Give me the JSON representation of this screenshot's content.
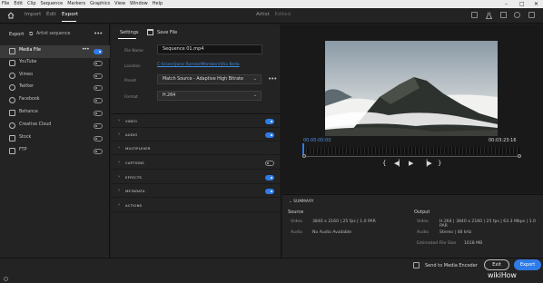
{
  "menu": [
    "File",
    "Edit",
    "Clip",
    "Sequence",
    "Markers",
    "Graphics",
    "View",
    "Window",
    "Help"
  ],
  "header": {
    "tabs": [
      {
        "label": "Import",
        "active": false
      },
      {
        "label": "Edit",
        "active": false
      },
      {
        "label": "Export",
        "active": true
      }
    ],
    "project": "Artist",
    "status": "Edited"
  },
  "left_panel": {
    "title": "Export",
    "sequence": "Artist sequence",
    "destinations": [
      {
        "label": "Media File",
        "on": true,
        "selected": true
      },
      {
        "label": "YouTube",
        "on": false
      },
      {
        "label": "Vimeo",
        "on": false
      },
      {
        "label": "Twitter",
        "on": false
      },
      {
        "label": "Facebook",
        "on": false
      },
      {
        "label": "Behance",
        "on": false
      },
      {
        "label": "Creative Cloud",
        "on": false
      },
      {
        "label": "Stock",
        "on": false
      },
      {
        "label": "FTP",
        "on": false
      }
    ]
  },
  "settings": {
    "tab": "Settings",
    "save_label": "Save File",
    "file_name_label": "File Name",
    "file_name": "Sequence 01.mp4",
    "location_label": "Location",
    "location": "C:\\Users\\Jane Romeo\\Members\\Rio Bella",
    "preset_label": "Preset",
    "preset": "Match Source - Adaptive High Bitrate",
    "format_label": "Format",
    "format": "H.264",
    "sections": [
      {
        "label": "VIDEO",
        "toggle": true,
        "on": true
      },
      {
        "label": "AUDIO",
        "toggle": true,
        "on": true
      },
      {
        "label": "MULTIPLEXER",
        "toggle": false
      },
      {
        "label": "CAPTIONS",
        "toggle": true,
        "on": false
      },
      {
        "label": "EFFECTS",
        "toggle": true,
        "on": true
      },
      {
        "label": "METADATA",
        "toggle": true,
        "on": true
      },
      {
        "label": "ACTIONS",
        "toggle": false
      }
    ]
  },
  "preview": {
    "tc_in": "00:00:00:00",
    "tc_out": "00:03:23:16",
    "playhead_position": 0.0
  },
  "summary": {
    "title": "SUMMARY",
    "source": {
      "heading": "Source",
      "video_label": "Video",
      "video": "3840 x 2160  |  25 fps  |  1.0 PAR",
      "audio_label": "Audio",
      "audio": "No Audio Available"
    },
    "output": {
      "heading": "Output",
      "video_label": "Video",
      "video": "H.264  |  3840 x 2160  |  25 fps  |  63.3 Mbps  |  1.0 PAR",
      "audio_label": "Audio",
      "audio": "Stereo  |  48 kHz",
      "size_label": "Estimated File Size",
      "size": "1618 MB"
    }
  },
  "bottom": {
    "send_encoder": "Send to Media Encoder",
    "exit": "Exit",
    "export": "Export",
    "watermark": "wikiHow"
  },
  "colors": {
    "accent": "#2f7be8",
    "panel": "#232323",
    "background": "#1d1d1d"
  }
}
